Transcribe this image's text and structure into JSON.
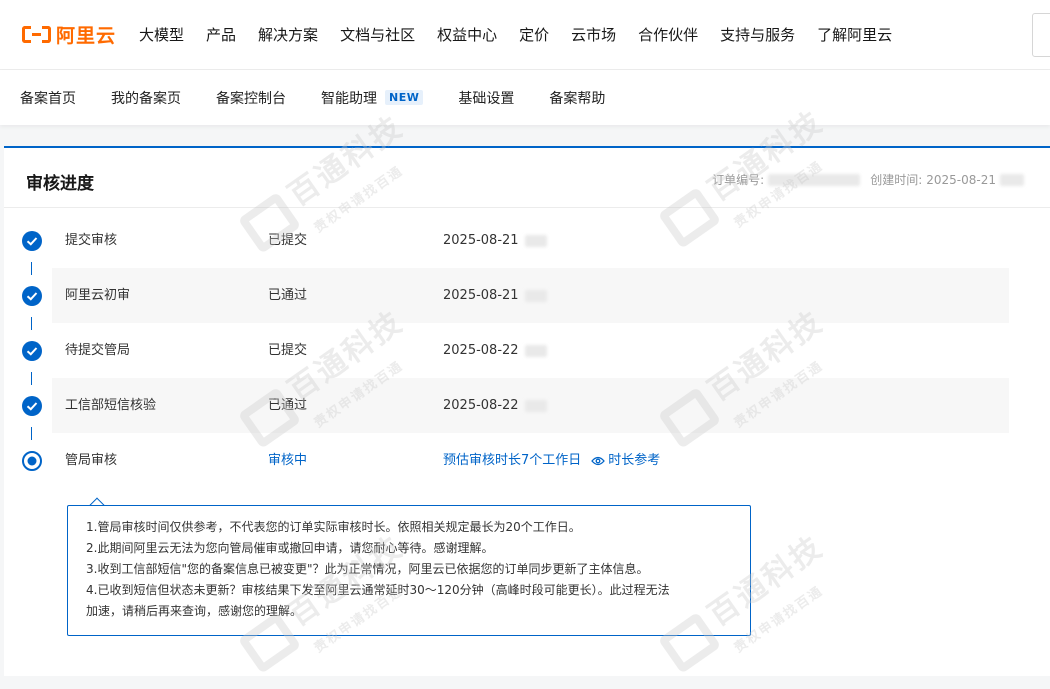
{
  "brand": {
    "logo_text": "阿里云",
    "accent": "#ff6a00"
  },
  "topnav": {
    "items": [
      "大模型",
      "产品",
      "解决方案",
      "文档与社区",
      "权益中心",
      "定价",
      "云市场",
      "合作伙伴",
      "支持与服务",
      "了解阿里云"
    ]
  },
  "subnav": {
    "items": [
      "备案首页",
      "我的备案页",
      "备案控制台",
      "智能助理",
      "基础设置",
      "备案帮助"
    ],
    "new_badge": "NEW"
  },
  "card": {
    "title": "审核进度",
    "order_label": "订单编号:",
    "created_label": "创建时间:",
    "created_date": "2025-08-21"
  },
  "steps": [
    {
      "name": "提交审核",
      "status": "已提交",
      "time": "2025-08-21",
      "done": true
    },
    {
      "name": "阿里云初审",
      "status": "已通过",
      "time": "2025-08-21",
      "done": true
    },
    {
      "name": "待提交管局",
      "status": "已提交",
      "time": "2025-08-22",
      "done": true
    },
    {
      "name": "工信部短信核验",
      "status": "已通过",
      "time": "2025-08-22",
      "done": true
    },
    {
      "name": "管局审核",
      "status": "审核中",
      "time": "预估审核时长7个工作日",
      "done": false,
      "link": "时长参考"
    }
  ],
  "tooltip": {
    "lines": [
      "1.管局审核时间仅供参考，不代表您的订单实际审核时长。依照相关规定最长为20个工作日。",
      "2.此期间阿里云无法为您向管局催审或撤回申请，请您耐心等待。感谢理解。",
      "3.收到工信部短信\"您的备案信息已被变更\"？此为正常情况，阿里云已依据您的订单同步更新了主体信息。",
      "4.已收到短信但状态未更新？审核结果下发至阿里云通常延时30～120分钟（高峰时段可能更长）。此过程无法",
      "加速，请稍后再来查询，感谢您的理解。"
    ]
  },
  "watermark": {
    "big": "百通科技",
    "small": "责权申请找百通"
  },
  "colors": {
    "primary": "#0064c8"
  }
}
